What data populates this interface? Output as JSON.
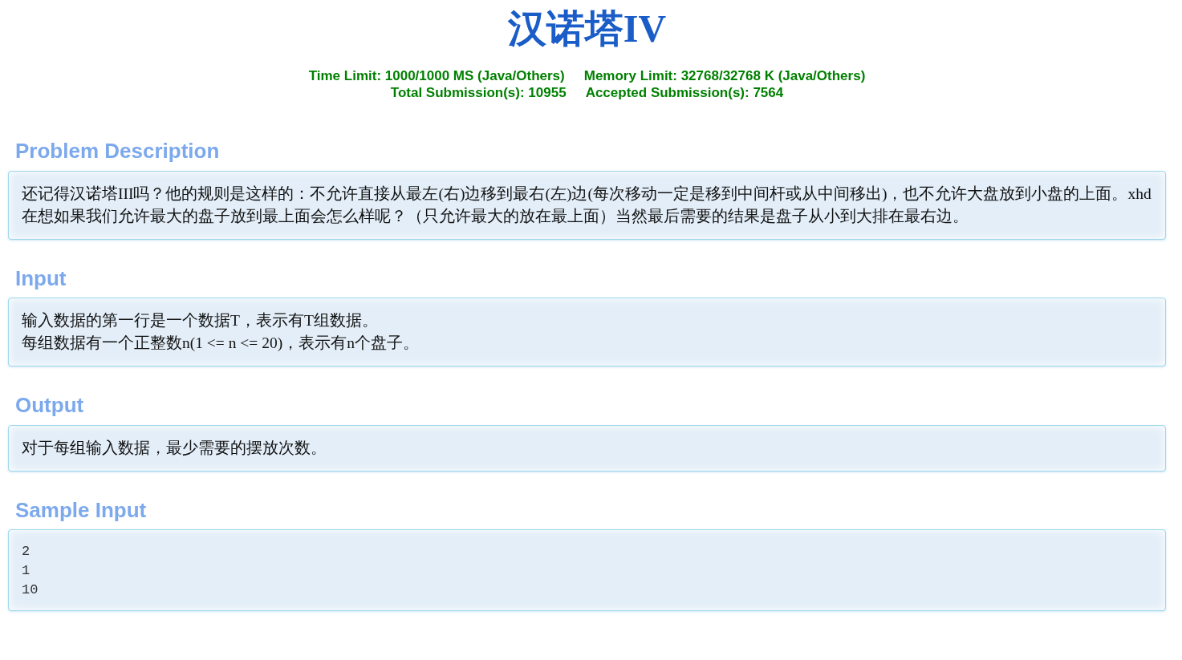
{
  "title": "汉诺塔IV",
  "limits": [
    [
      "Time Limit: 1000/1000 MS (Java/Others)",
      "Memory Limit: 32768/32768 K (Java/Others)"
    ],
    [
      "Total Submission(s): 10955",
      "Accepted Submission(s): 7564"
    ]
  ],
  "sections": [
    {
      "heading": "Problem Description",
      "kind": "text",
      "lines": [
        "还记得汉诺塔III吗？他的规则是这样的：不允许直接从最左(右)边移到最右(左)边(每次移动一定是移到中间杆或从中间移出)，也不允许大盘放到小盘的上面。xhd在想如果我们允许最大的盘子放到最上面会怎么样呢？（只允许最大的放在最上面）当然最后需要的结果是盘子从小到大排在最右边。"
      ]
    },
    {
      "heading": "Input",
      "kind": "text",
      "lines": [
        "输入数据的第一行是一个数据T，表示有T组数据。",
        "每组数据有一个正整数n(1 <= n <= 20)，表示有n个盘子。"
      ]
    },
    {
      "heading": "Output",
      "kind": "text",
      "lines": [
        "对于每组输入数据，最少需要的摆放次数。"
      ]
    },
    {
      "heading": "Sample Input",
      "kind": "code",
      "lines": [
        "2",
        "1",
        "10"
      ]
    }
  ]
}
